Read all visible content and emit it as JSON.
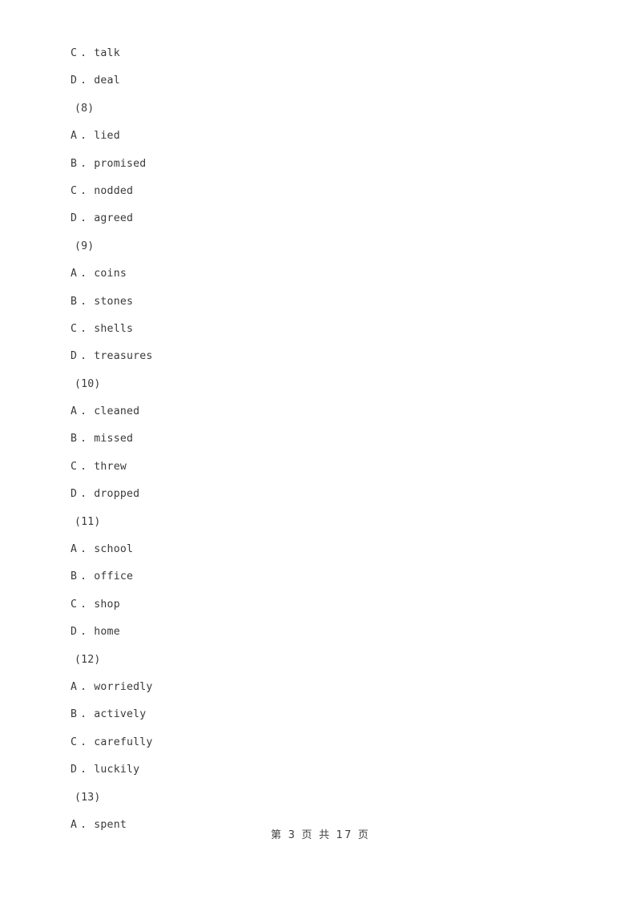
{
  "page": {
    "background_color": "#ffffff",
    "text_color": "#3a3a3a"
  },
  "document": {
    "blocks": [
      {
        "kind": "option",
        "letter": "C",
        "separator": ".",
        "text": "talk"
      },
      {
        "kind": "option",
        "letter": "D",
        "separator": ".",
        "text": "deal"
      },
      {
        "kind": "question",
        "label": "(8)"
      },
      {
        "kind": "option",
        "letter": "A",
        "separator": ".",
        "text": "lied"
      },
      {
        "kind": "option",
        "letter": "B",
        "separator": ".",
        "text": "promised"
      },
      {
        "kind": "option",
        "letter": "C",
        "separator": ".",
        "text": "nodded"
      },
      {
        "kind": "option",
        "letter": "D",
        "separator": ".",
        "text": "agreed"
      },
      {
        "kind": "question",
        "label": "(9)"
      },
      {
        "kind": "option",
        "letter": "A",
        "separator": ".",
        "text": "coins"
      },
      {
        "kind": "option",
        "letter": "B",
        "separator": ".",
        "text": "stones"
      },
      {
        "kind": "option",
        "letter": "C",
        "separator": ".",
        "text": "shells"
      },
      {
        "kind": "option",
        "letter": "D",
        "separator": ".",
        "text": "treasures"
      },
      {
        "kind": "question",
        "label": "(10)"
      },
      {
        "kind": "option",
        "letter": "A",
        "separator": ".",
        "text": "cleaned"
      },
      {
        "kind": "option",
        "letter": "B",
        "separator": ".",
        "text": "missed"
      },
      {
        "kind": "option",
        "letter": "C",
        "separator": ".",
        "text": "threw"
      },
      {
        "kind": "option",
        "letter": "D",
        "separator": ".",
        "text": "dropped"
      },
      {
        "kind": "question",
        "label": "(11)"
      },
      {
        "kind": "option",
        "letter": "A",
        "separator": ".",
        "text": "school"
      },
      {
        "kind": "option",
        "letter": "B",
        "separator": ".",
        "text": "office"
      },
      {
        "kind": "option",
        "letter": "C",
        "separator": ".",
        "text": "shop"
      },
      {
        "kind": "option",
        "letter": "D",
        "separator": ".",
        "text": "home"
      },
      {
        "kind": "question",
        "label": "(12)"
      },
      {
        "kind": "option",
        "letter": "A",
        "separator": ".",
        "text": "worriedly"
      },
      {
        "kind": "option",
        "letter": "B",
        "separator": ".",
        "text": "actively"
      },
      {
        "kind": "option",
        "letter": "C",
        "separator": ".",
        "text": "carefully"
      },
      {
        "kind": "option",
        "letter": "D",
        "separator": ".",
        "text": "luckily"
      },
      {
        "kind": "question",
        "label": "(13)"
      },
      {
        "kind": "option",
        "letter": "A",
        "separator": ".",
        "text": "spent"
      }
    ]
  },
  "footer": {
    "prefix": "第",
    "current_page": "3",
    "page_unit": "页",
    "of_label": "共",
    "total_pages": "17",
    "total_unit": "页",
    "full_text": "第 3 页 共 17 页"
  }
}
